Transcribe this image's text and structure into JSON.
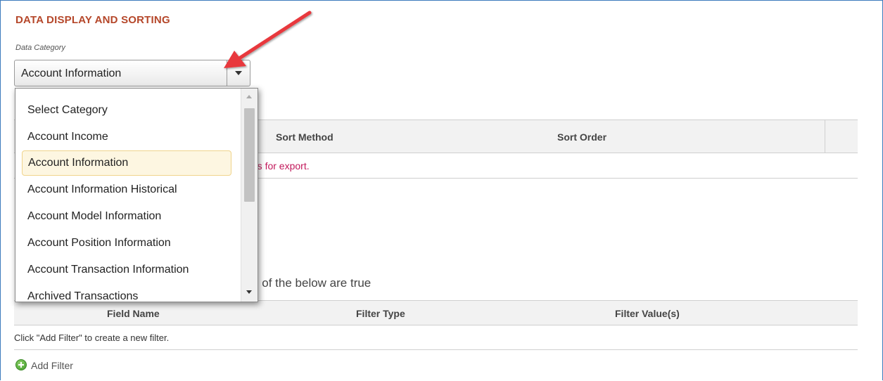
{
  "section": {
    "title": "DATA DISPLAY AND SORTING"
  },
  "category": {
    "label": "Data Category",
    "selected": "Account Information"
  },
  "dropdown": {
    "items": [
      "Select Category",
      "Account Income",
      "Account Information",
      "Account Information Historical",
      "Account Model Information",
      "Account Position Information",
      "Account Transaction Information",
      "Archived Transactions"
    ],
    "selected_index": 2
  },
  "sort_table": {
    "columns": [
      "Sort Method",
      "Sort Order"
    ],
    "message": "fields for export."
  },
  "filters": {
    "intro": "ll of the below are true",
    "columns": [
      "Field Name",
      "Filter Type",
      "Filter Value(s)"
    ],
    "empty_message": "Click \"Add Filter\" to create a new filter.",
    "add_label": "Add Filter"
  },
  "colors": {
    "section_title": "#b5472a",
    "message": "#c2185b",
    "annotation_arrow": "#e8383d",
    "selected_item_bg": "#fdf6e1"
  },
  "icons": {
    "dropdown_caret": "chevron-down-icon",
    "add_filter": "plus-circle-icon"
  }
}
